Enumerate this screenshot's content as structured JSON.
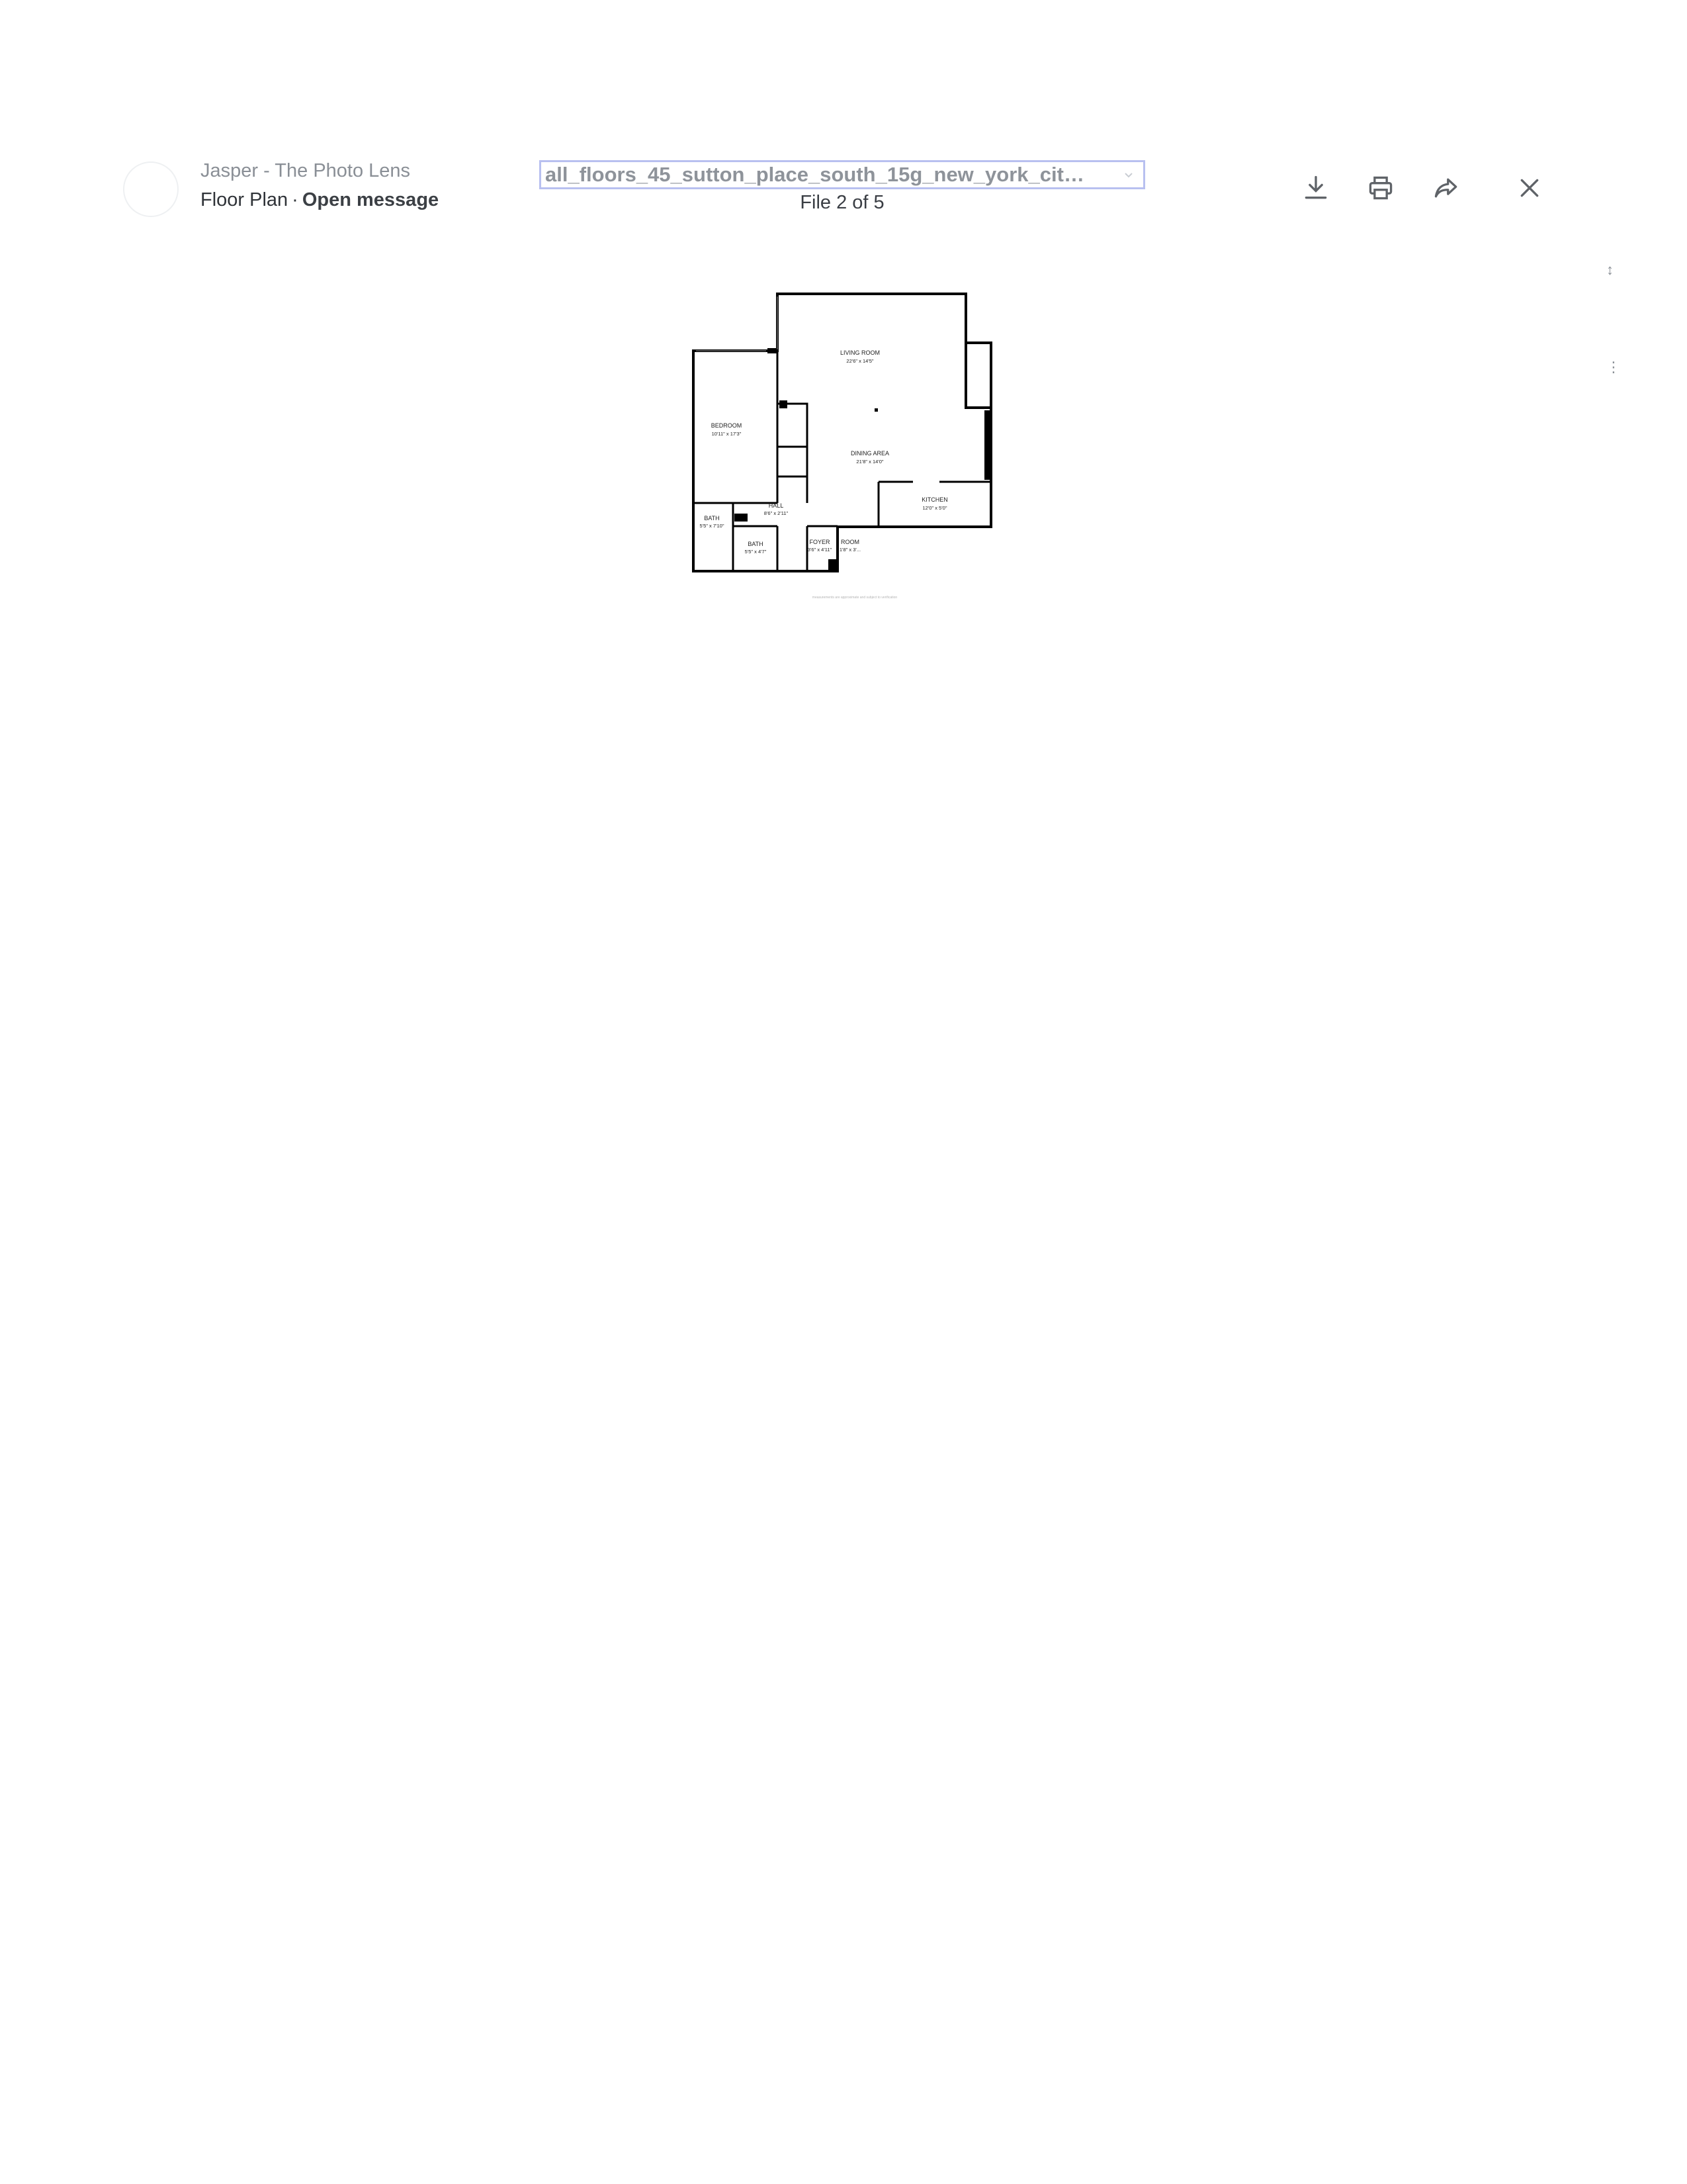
{
  "header": {
    "sender": "Jasper - The Photo Lens",
    "subject": "Floor Plan",
    "separator": "·",
    "open_message": "Open message",
    "file_name": "all_floors_45_sutton_place_south_15g_new_york_city_wi...",
    "file_counter": "File 2 of 5"
  },
  "toolbar": {
    "download_icon": "download-icon",
    "print_icon": "print-icon",
    "share_icon": "share-forward-icon",
    "close_icon": "close-icon"
  },
  "floorplan": {
    "rooms": [
      {
        "name": "LIVING ROOM",
        "dims": "22'6\" x 14'5\""
      },
      {
        "name": "BEDROOM",
        "dims": "10'11\" x 17'3\""
      },
      {
        "name": "DINING AREA",
        "dims": "21'8\" x 14'0\""
      },
      {
        "name": "KITCHEN",
        "dims": "12'0\" x 5'0\""
      },
      {
        "name": "HALL",
        "dims": "8'6\" x 2'11\""
      },
      {
        "name": "BATH",
        "dims": "5'5\" x 7'10\""
      },
      {
        "name": "BATH",
        "dims": "5'5\" x 4'7\""
      },
      {
        "name": "FOYER",
        "dims": "3'6\" x 4'11\""
      },
      {
        "name": "ROOM",
        "dims": "1'8\" x 3'..."
      }
    ],
    "footnote": "measurements are approximate and subject to verification"
  },
  "colors": {
    "text_primary": "#2f3338",
    "text_muted": "#8a8f96",
    "focus_border": "#b8c0f0",
    "icon": "#5f6368"
  }
}
